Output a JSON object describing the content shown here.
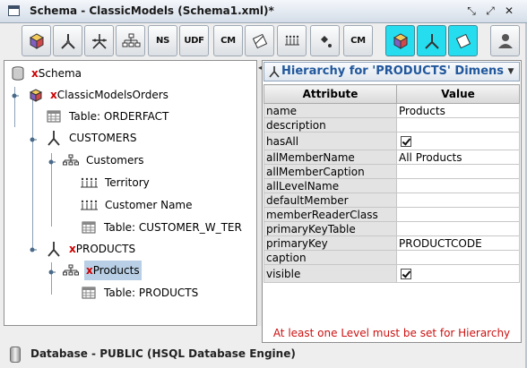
{
  "window": {
    "title": "Schema - ClassicModels (Schema1.xml)*",
    "controls": [
      "maximize-restore",
      "minimize",
      "close"
    ]
  },
  "toolbar": {
    "buttons": [
      {
        "name": "add-cube",
        "label": "",
        "icon": "cube-add-icon"
      },
      {
        "name": "add-dimension",
        "label": "",
        "icon": "dimension-add-icon"
      },
      {
        "name": "add-dimension-usage",
        "label": "",
        "icon": "dimension-usage-icon"
      },
      {
        "name": "add-hierarchy",
        "label": "",
        "icon": "hierarchy-add-icon"
      },
      {
        "name": "add-named-set",
        "label": "NS",
        "icon": "named-set-icon"
      },
      {
        "name": "add-udf",
        "label": "UDF",
        "icon": "udf-icon"
      },
      {
        "name": "add-calculated-member",
        "label": "CM",
        "icon": "calculated-member-icon"
      },
      {
        "name": "add-measure",
        "label": "",
        "icon": "measure-add-icon"
      },
      {
        "name": "add-level",
        "label": "",
        "icon": "level-add-icon"
      },
      {
        "name": "add-property",
        "label": "",
        "icon": "property-add-icon"
      },
      {
        "name": "add-virtual-calculated-member",
        "label": "CM",
        "icon": "virtual-cm-icon"
      },
      {
        "name": "add-virtual-cube",
        "label": "",
        "icon": "virtual-cube-icon"
      },
      {
        "name": "add-virtual-dimension",
        "label": "",
        "icon": "virtual-dimension-icon"
      },
      {
        "name": "add-virtual-measure",
        "label": "",
        "icon": "virtual-measure-icon"
      },
      {
        "name": "grant-role",
        "label": "",
        "icon": "user-role-icon"
      }
    ]
  },
  "tree": {
    "nodes": [
      {
        "label": "Schema",
        "prefix_x": "x",
        "icon": "schema-icon"
      },
      {
        "label": "ClassicModelsOrders",
        "prefix_x": "x",
        "icon": "cube-icon"
      },
      {
        "label": "Table: ORDERFACT",
        "prefix_x": "",
        "icon": "table-icon"
      },
      {
        "label": "CUSTOMERS",
        "prefix_x": "",
        "icon": "dimension-icon"
      },
      {
        "label": "Customers",
        "prefix_x": "",
        "icon": "hierarchy-icon"
      },
      {
        "label": "Territory",
        "prefix_x": "",
        "icon": "level-icon"
      },
      {
        "label": "Customer Name",
        "prefix_x": "",
        "icon": "level-icon"
      },
      {
        "label": "Table: CUSTOMER_W_TER",
        "prefix_x": "",
        "icon": "table-icon"
      },
      {
        "label": "PRODUCTS",
        "prefix_x": "x",
        "icon": "dimension-icon"
      },
      {
        "label": "Products",
        "prefix_x": "x",
        "icon": "hierarchy-icon",
        "selected": true
      },
      {
        "label": "Table: PRODUCTS",
        "prefix_x": "",
        "icon": "table-icon"
      }
    ]
  },
  "properties": {
    "header": "Hierarchy for 'PRODUCTS' Dimensi...",
    "columns": [
      "Attribute",
      "Value"
    ],
    "rows": [
      {
        "attr": "name",
        "value": "Products"
      },
      {
        "attr": "description",
        "value": ""
      },
      {
        "attr": "hasAll",
        "value": "",
        "checkbox": true,
        "checked": true
      },
      {
        "attr": "allMemberName",
        "value": "All Products"
      },
      {
        "attr": "allMemberCaption",
        "value": ""
      },
      {
        "attr": "allLevelName",
        "value": ""
      },
      {
        "attr": "defaultMember",
        "value": ""
      },
      {
        "attr": "memberReaderClass",
        "value": ""
      },
      {
        "attr": "primaryKeyTable",
        "value": ""
      },
      {
        "attr": "primaryKey",
        "value": "PRODUCTCODE"
      },
      {
        "attr": "caption",
        "value": ""
      },
      {
        "attr": "visible",
        "value": "",
        "checkbox": true,
        "checked": true
      }
    ],
    "error": "At least one Level must be set for Hierarchy"
  },
  "status": {
    "text": "Database - PUBLIC (HSQL Database Engine)"
  }
}
